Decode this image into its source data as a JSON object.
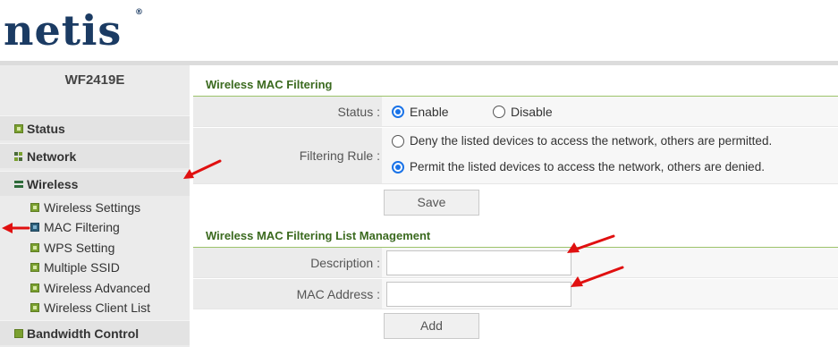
{
  "brand": {
    "logo_text": "netis",
    "reg_mark": "®"
  },
  "sidebar": {
    "model": "WF2419E",
    "menu": [
      {
        "label": "Status",
        "icon": "status-icon"
      },
      {
        "label": "Network",
        "icon": "network-icon"
      },
      {
        "label": "Wireless",
        "icon": "wireless-icon"
      }
    ],
    "wireless_sub": [
      {
        "label": "Wireless Settings"
      },
      {
        "label": "MAC Filtering"
      },
      {
        "label": "WPS Setting"
      },
      {
        "label": "Multiple SSID"
      },
      {
        "label": "Wireless Advanced"
      },
      {
        "label": "Wireless Client List"
      }
    ],
    "bandwidth": {
      "label": "Bandwidth Control"
    }
  },
  "filtering": {
    "title": "Wireless MAC Filtering",
    "status_label": "Status :",
    "enable_label": "Enable",
    "disable_label": "Disable",
    "status_value": "Enable",
    "rule_label": "Filtering Rule :",
    "deny_label": "Deny the listed devices to access the network, others are permitted.",
    "permit_label": "Permit the listed devices to access the network, others are denied.",
    "rule_value": "permit",
    "save_label": "Save"
  },
  "list_mgmt": {
    "title": "Wireless MAC Filtering List Management",
    "description_label": "Description :",
    "description_value": "",
    "mac_label": "MAC Address :",
    "mac_value": "",
    "add_label": "Add"
  },
  "colors": {
    "brand": "#1b3b63",
    "section_title": "#3b6a1f",
    "radio_accent": "#1a73e8",
    "annotation": "#e01010"
  }
}
